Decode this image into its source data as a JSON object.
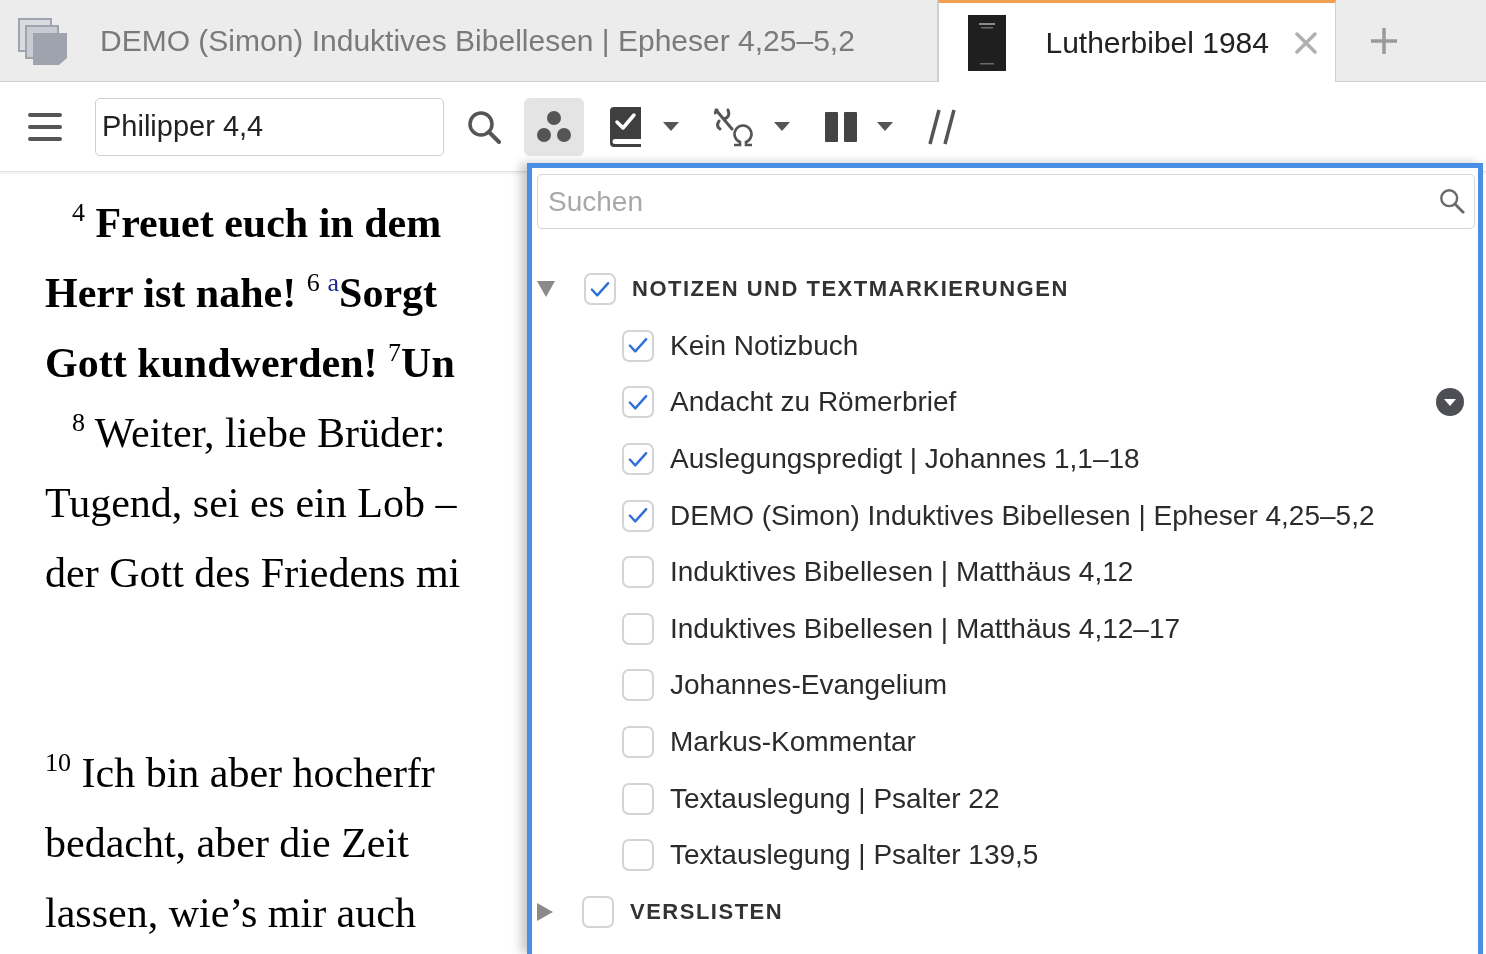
{
  "tabs": [
    {
      "label": "DEMO (Simon) Induktives Bibellesen | Epheser 4,25–5,2",
      "kind": "document",
      "selected": false
    },
    {
      "label": "Lutherbibel 1984",
      "kind": "bible",
      "selected": true
    }
  ],
  "toolbar": {
    "reference": {
      "value": "Philipper 4,4"
    },
    "buttons": [
      {
        "kind": "search",
        "selected": false,
        "dropdown": false
      },
      {
        "kind": "visual_filters",
        "selected": true,
        "dropdown": false
      },
      {
        "kind": "notes",
        "selected": false,
        "dropdown": true
      },
      {
        "kind": "original_language",
        "selected": false,
        "dropdown": true
      },
      {
        "kind": "columns",
        "selected": false,
        "dropdown": true
      },
      {
        "kind": "parallel",
        "selected": false,
        "dropdown": false
      }
    ]
  },
  "reader": {
    "sections": [
      {
        "lines": [
          {
            "indent": true,
            "parts": [
              {
                "kind": "text",
                "text": "$^{4}$ **Freuet euch in dem**"
              }
            ]
          },
          {
            "indent": false,
            "parts": [
              {
                "kind": "text",
                "text": "**Herr ist nahe!** $^{6}$"
              },
              {
                "kind": "note",
                "text": "a"
              },
              {
                "kind": "text",
                "text": "**Sorgt**"
              }
            ]
          },
          {
            "indent": false,
            "parts": [
              {
                "kind": "text",
                "text": "**Gott kundwerden!** $^{7}$**Un**"
              }
            ]
          },
          {
            "indent": true,
            "parts": [
              {
                "kind": "text",
                "text": "$^{8}$ Weiter, liebe Brüder:"
              }
            ]
          },
          {
            "indent": false,
            "parts": [
              {
                "kind": "text",
                "text": "Tugend, sei es ein Lob –"
              }
            ]
          },
          {
            "indent": false,
            "parts": [
              {
                "kind": "text",
                "text": "der Gott des Friedens mi"
              }
            ]
          }
        ]
      },
      {
        "lines": [
          {
            "indent": false,
            "parts": [
              {
                "kind": "text",
                "text": "$^{10}$ Ich bin aber hocherfr"
              }
            ]
          },
          {
            "indent": false,
            "parts": [
              {
                "kind": "text",
                "text": "bedacht, aber die Zeit"
              }
            ]
          },
          {
            "indent": false,
            "parts": [
              {
                "kind": "text",
                "text": "lassen, wie’s mir auch"
              }
            ]
          }
        ]
      }
    ]
  },
  "filter_panel": {
    "search": {
      "placeholder": "Suchen"
    },
    "groups": [
      {
        "label": "NOTIZEN UND TEXTMARKIERUNGEN",
        "expanded": true,
        "checked": true,
        "items": [
          {
            "label": "Kein Notizbuch",
            "checked": true,
            "hovered": false
          },
          {
            "label": "Andacht zu Römerbrief",
            "checked": true,
            "hovered": true
          },
          {
            "label": "Auslegungspredigt | Johannes 1,1–18",
            "checked": true,
            "hovered": false
          },
          {
            "label": "DEMO (Simon) Induktives Bibellesen | Epheser 4,25–5,2",
            "checked": true,
            "hovered": false
          },
          {
            "label": "Induktives Bibellesen | Matthäus 4,12",
            "checked": false,
            "hovered": false
          },
          {
            "label": "Induktives Bibellesen | Matthäus 4,12–17",
            "checked": false,
            "hovered": false
          },
          {
            "label": "Johannes-Evangelium",
            "checked": false,
            "hovered": false
          },
          {
            "label": "Markus-Kommentar",
            "checked": false,
            "hovered": false
          },
          {
            "label": "Textauslegung | Psalter 22",
            "checked": false,
            "hovered": false
          },
          {
            "label": "Textauslegung | Psalter 139,5",
            "checked": false,
            "hovered": false
          }
        ]
      },
      {
        "label": "VERSLISTEN",
        "expanded": false,
        "checked": false
      }
    ]
  }
}
